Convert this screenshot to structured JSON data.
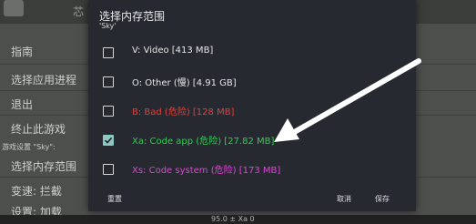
{
  "background": {
    "tab_label": "芯",
    "menu_items": [
      "指南",
      "选择应用进程",
      "退出",
      "终止此游戏",
      "选择内存范围",
      "变速: 拦截",
      "设置: 加载"
    ],
    "caption": "游戏设置 \"Sky\":",
    "status": "95.0 ± Xa 0"
  },
  "dialog": {
    "title": "选择内存范围",
    "subtitle": "'Sky'",
    "options": [
      {
        "label": "V: Video [413 MB]",
        "checked": false,
        "color": "#e6e6e6"
      },
      {
        "label": "O: Other (慢) [4.91 GB]",
        "checked": false,
        "color": "#e6e6e6"
      },
      {
        "label": "B: Bad (危险) [128 MB]",
        "checked": false,
        "color": "#e0403a"
      },
      {
        "label": "Xa: Code app (危险) [27.82 MB]",
        "checked": true,
        "color": "#2fcf4f"
      },
      {
        "label": "Xs: Code system (危险) [173 MB]",
        "checked": false,
        "color": "#e143d8"
      }
    ],
    "buttons": {
      "reset": "重置",
      "cancel": "取消",
      "save": "保存"
    }
  },
  "colors": {
    "dialog_bg": "#262a30",
    "checkbox_checked": "#8fc7c3",
    "arrow": "#ffffff"
  }
}
